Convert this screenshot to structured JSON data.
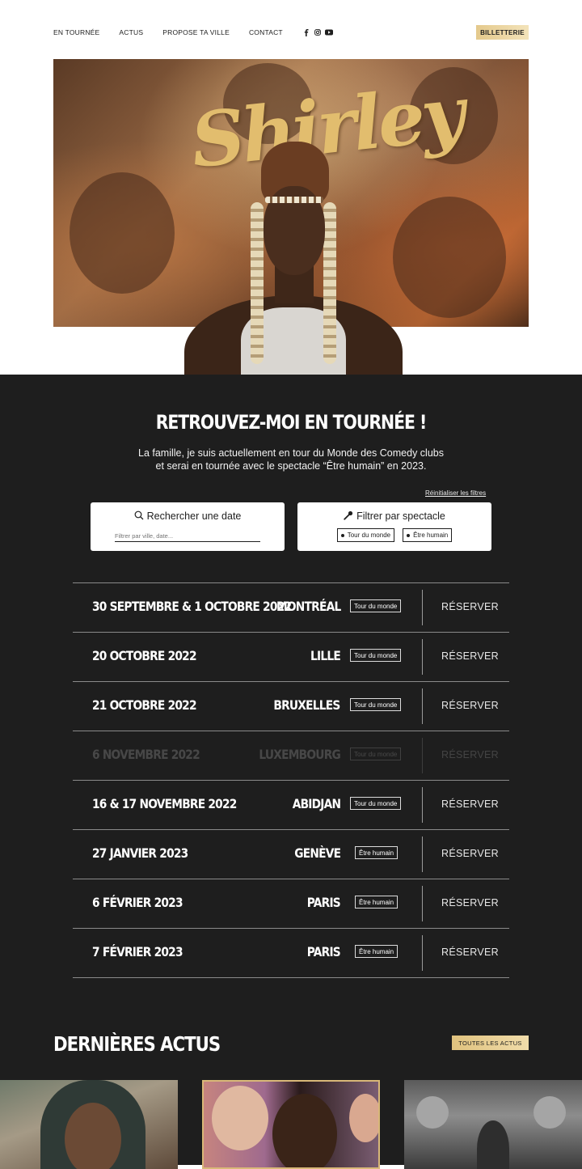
{
  "nav": {
    "links": [
      "EN TOURNÉE",
      "ACTUS",
      "PROPOSE TA VILLE",
      "CONTACT"
    ],
    "social_icons": [
      "facebook-icon",
      "instagram-icon",
      "youtube-icon"
    ],
    "billetterie": "BILLETTERIE"
  },
  "hero": {
    "title": "Shirley"
  },
  "tour": {
    "title": "RETROUVEZ-MOI EN TOURNÉE !",
    "intro_line1": "La famille, je suis actuellement en tour du Monde des Comedy clubs",
    "intro_line2": "et serai en tournée avec le spectacle “Être humain” en 2023.",
    "reset_filters": "Réinitialiser les filtres",
    "search": {
      "label": "Rechercher une date",
      "placeholder": "Filtrer par ville, date..."
    },
    "show_filter": {
      "label": "Filtrer par spectacle",
      "options": [
        "Tour du monde",
        "Être humain"
      ]
    },
    "dates": [
      {
        "date": "30 SEPTEMBRE & 1 OCTOBRE 2022",
        "city": "MONTRÉAL",
        "show": "Tour du monde",
        "action": "RÉSERVER",
        "faded": false
      },
      {
        "date": "20 OCTOBRE 2022",
        "city": "LILLE",
        "show": "Tour du monde",
        "action": "RÉSERVER",
        "faded": false
      },
      {
        "date": "21 OCTOBRE 2022",
        "city": "BRUXELLES",
        "show": "Tour du monde",
        "action": "RÉSERVER",
        "faded": false
      },
      {
        "date": "6 NOVEMBRE 2022",
        "city": "LUXEMBOURG",
        "show": "Tour du monde",
        "action": "RÉSERVER",
        "faded": true
      },
      {
        "date": "16 & 17 NOVEMBRE 2022",
        "city": "ABIDJAN",
        "show": "Tour du monde",
        "action": "RÉSERVER",
        "faded": false
      },
      {
        "date": "27 JANVIER 2023",
        "city": "GENÈVE",
        "show": "Être humain",
        "action": "RÉSERVER",
        "faded": false
      },
      {
        "date": "6 FÉVRIER 2023",
        "city": "PARIS",
        "show": "Être humain",
        "action": "RÉSERVER",
        "faded": false
      },
      {
        "date": "7 FÉVRIER 2023",
        "city": "PARIS",
        "show": "Être humain",
        "action": "RÉSERVER",
        "faded": false
      }
    ]
  },
  "news": {
    "title": "DERNIÈRES ACTUS",
    "all_news": "TOUTES LES ACTUS"
  },
  "colors": {
    "dark_bg": "#1e1e1e",
    "gold": "#e4c98c",
    "white": "#ffffff"
  }
}
